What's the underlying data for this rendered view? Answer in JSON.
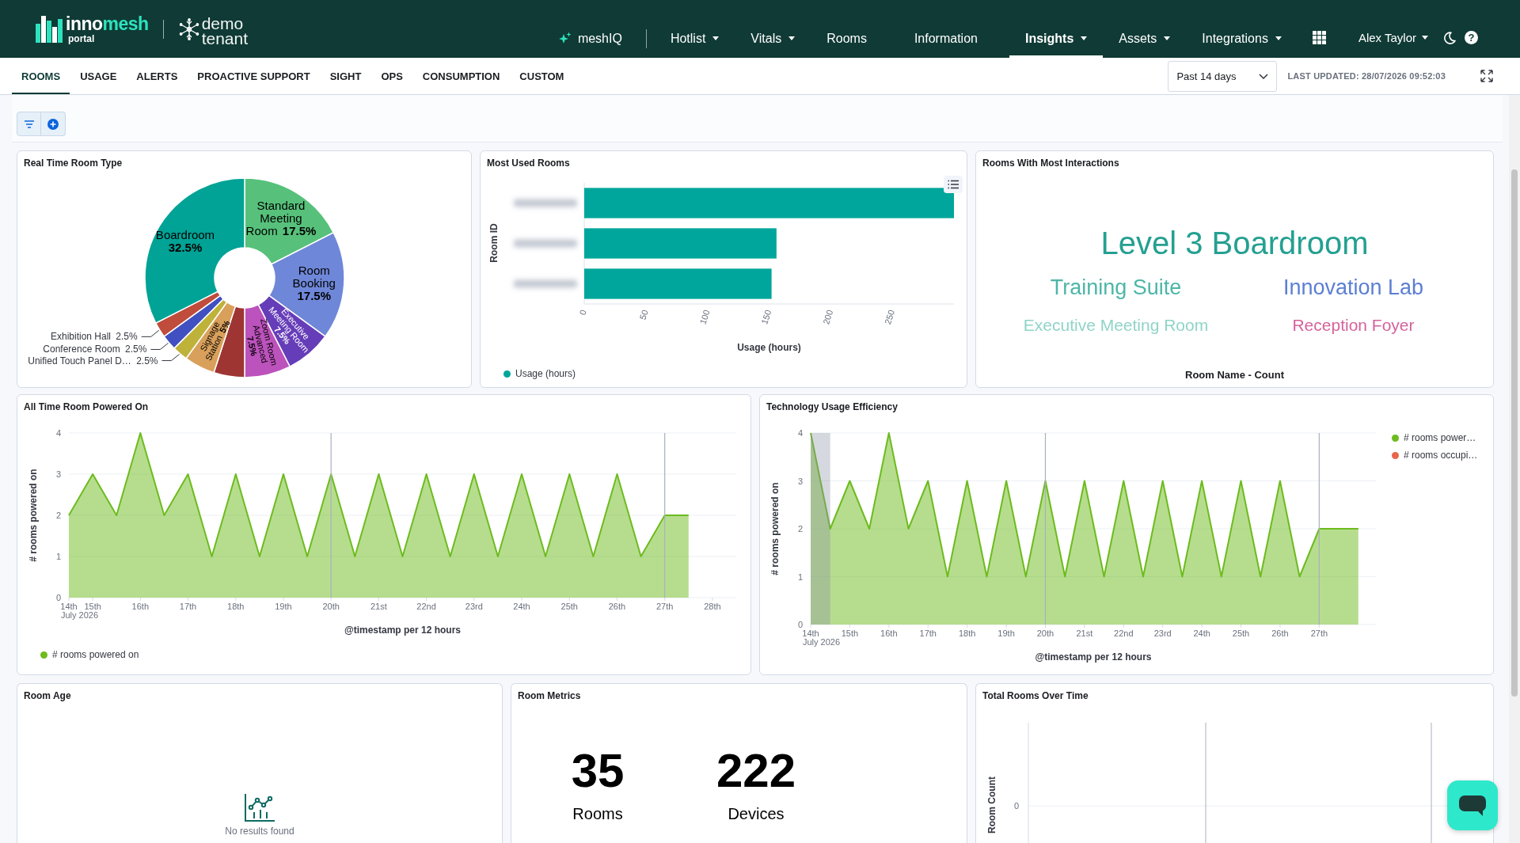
{
  "header": {
    "logo": {
      "text_start": "inno",
      "text_end": "mesh",
      "subtitle": "portal"
    },
    "tenant": "demo tenant",
    "nav": [
      {
        "label": "meshIQ",
        "kind": "assistant",
        "dropdown": false,
        "selected": false
      },
      {
        "label": "Hotlist",
        "kind": "link",
        "dropdown": true,
        "selected": false
      },
      {
        "label": "Vitals",
        "kind": "link",
        "dropdown": true,
        "selected": false
      },
      {
        "label": "Rooms",
        "kind": "link",
        "dropdown": false,
        "selected": false
      },
      {
        "label": "Information",
        "kind": "link",
        "dropdown": false,
        "selected": false
      },
      {
        "label": "Insights",
        "kind": "link",
        "dropdown": true,
        "selected": true
      },
      {
        "label": "Assets",
        "kind": "link",
        "dropdown": true,
        "selected": false
      },
      {
        "label": "Integrations",
        "kind": "link",
        "dropdown": true,
        "selected": false
      }
    ],
    "user": {
      "name": "Alex Taylor"
    },
    "help": "?"
  },
  "tabs": [
    {
      "label": "ROOMS",
      "selected": true
    },
    {
      "label": "USAGE",
      "selected": false
    },
    {
      "label": "ALERTS",
      "selected": false
    },
    {
      "label": "PROACTIVE SUPPORT",
      "selected": false
    },
    {
      "label": "SIGHT",
      "selected": false
    },
    {
      "label": "OPS",
      "selected": false
    },
    {
      "label": "CONSUMPTION",
      "selected": false
    },
    {
      "label": "CUSTOM",
      "selected": false
    }
  ],
  "toolbar": {
    "time_range": "Past 14 days",
    "last_updated": "LAST UPDATED: 28/07/2026 09:52:03"
  },
  "room_type_panel": {
    "title": "Real Time Room Type",
    "chart_data": {
      "type": "donut",
      "categories": [
        "Standard Meeting Room",
        "Room Booking",
        "Executive Meeting Room",
        "Zoom Room Advanced",
        null,
        "Signage Station",
        "Unified Touch Panel D…",
        "Conference Room",
        "Exhibition Hall",
        "Boardroom"
      ],
      "values": [
        17.5,
        17.5,
        7.5,
        7.5,
        5,
        5,
        2.5,
        2.5,
        2.5,
        32.5
      ],
      "value_labels": [
        "17.5%",
        "17.5%",
        "7.5%",
        "7.5%",
        null,
        "5%",
        "2.5%",
        "2.5%",
        "2.5%",
        "32.5%"
      ],
      "colors": [
        "#57c17b",
        "#6f87d8",
        "#663db8",
        "#bc52bc",
        "#9e3533",
        "#d9a05b",
        "#bfb23a",
        "#4050c0",
        "#c04c3c",
        "#00a396"
      ]
    }
  },
  "most_used_rooms_panel": {
    "title": "Most Used Rooms",
    "chart_data": {
      "type": "bar",
      "orientation": "horizontal",
      "xlabel": "Usage (hours)",
      "ylabel": "Room ID",
      "xlim": [
        0,
        300
      ],
      "xticks": [
        0,
        50,
        100,
        150,
        200,
        250
      ],
      "series": [
        {
          "name": "Usage (hours)",
          "color": "#00a69b",
          "values": [
            300,
            156,
            152
          ]
        }
      ]
    }
  },
  "interactions_panel": {
    "title": "Rooms With Most Interactions",
    "words": [
      {
        "text": "Level 3 Boardroom",
        "color": "#24a091"
      },
      {
        "text": "Training Suite",
        "color": "#4db6a8"
      },
      {
        "text": "Innovation Lab",
        "color": "#5c7fd3"
      },
      {
        "text": "Executive Meeting Room",
        "color": "#8fd4c8"
      },
      {
        "text": "Reception Foyer",
        "color": "#d5629c"
      }
    ],
    "caption": "Room Name - Count"
  },
  "powered_on_panel": {
    "title": "All Time Room Powered On",
    "date_caption": "July 2026",
    "chart_data": {
      "type": "area",
      "xlabel": "@timestamp per 12 hours",
      "ylabel": "# rooms powered on",
      "grid": true,
      "x": [
        14.5,
        15,
        15.5,
        16,
        16.5,
        17,
        17.5,
        18,
        18.5,
        19,
        19.5,
        20,
        20.5,
        21,
        21.5,
        22,
        22.5,
        23,
        23.5,
        24,
        24.5,
        25,
        25.5,
        26,
        26.5,
        27,
        27.5
      ],
      "series": [
        {
          "name": "# rooms powered on",
          "color": "#6dbb1e",
          "values": [
            2,
            3,
            2,
            4,
            2,
            3,
            1,
            3,
            1,
            3,
            1,
            3,
            1,
            3,
            1,
            3,
            1,
            3,
            1,
            3,
            1,
            3,
            1,
            3,
            1,
            2,
            2
          ]
        }
      ],
      "xlim": [
        14.5,
        28.5
      ],
      "ylim": [
        0,
        4
      ],
      "yticks": [
        0,
        1,
        2,
        3,
        4
      ],
      "xticks": [
        {
          "value": 14.5,
          "label": "14th"
        },
        {
          "value": 15,
          "label": "15th"
        },
        {
          "value": 16,
          "label": "16th"
        },
        {
          "value": 17,
          "label": "17th"
        },
        {
          "value": 18,
          "label": "18th"
        },
        {
          "value": 19,
          "label": "19th"
        },
        {
          "value": 20,
          "label": "20th"
        },
        {
          "value": 21,
          "label": "21st"
        },
        {
          "value": 22,
          "label": "22nd"
        },
        {
          "value": 23,
          "label": "23rd"
        },
        {
          "value": 24,
          "label": "24th"
        },
        {
          "value": 25,
          "label": "25th"
        },
        {
          "value": 26,
          "label": "26th"
        },
        {
          "value": 27,
          "label": "27th"
        },
        {
          "value": 28,
          "label": "28th"
        }
      ],
      "ref_lines": [
        {
          "axis": "x",
          "value": 20
        },
        {
          "axis": "x",
          "value": 27
        }
      ]
    }
  },
  "efficiency_panel": {
    "title": "Technology Usage Efficiency",
    "date_caption": "July 2026",
    "chart_data": {
      "type": "area",
      "xlabel": "@timestamp per 12 hours",
      "ylabel": "# rooms powered on",
      "grid": true,
      "x": [
        14,
        14.5,
        15,
        15.5,
        16,
        16.5,
        17,
        17.5,
        18,
        18.5,
        19,
        19.5,
        20,
        20.5,
        21,
        21.5,
        22,
        22.5,
        23,
        23.5,
        24,
        24.5,
        25,
        25.5,
        26,
        26.5,
        27,
        27.5,
        28
      ],
      "series": [
        {
          "name": "# rooms power…",
          "color": "#6dbb1e",
          "values": [
            4,
            2,
            3,
            2,
            4,
            2,
            3,
            1,
            3,
            1,
            3,
            1,
            3,
            1,
            3,
            1,
            3,
            1,
            3,
            1,
            3,
            1,
            3,
            1,
            3,
            1,
            2,
            2,
            2
          ]
        },
        {
          "name": "# rooms occupi…",
          "color": "#e7664c",
          "values": [
            null,
            null,
            null,
            null,
            null,
            null,
            null,
            null,
            null,
            null,
            null,
            null,
            null,
            null,
            null,
            null,
            null,
            null,
            null,
            null,
            null,
            null,
            null,
            null,
            null,
            null,
            null,
            null,
            null
          ]
        }
      ],
      "xlim": [
        14,
        28.45
      ],
      "ylim": [
        0,
        4
      ],
      "yticks": [
        0,
        1,
        2,
        3,
        4
      ],
      "xticks": [
        {
          "value": 14,
          "label": "14th"
        },
        {
          "value": 15,
          "label": "15th"
        },
        {
          "value": 16,
          "label": "16th"
        },
        {
          "value": 17,
          "label": "17th"
        },
        {
          "value": 18,
          "label": "18th"
        },
        {
          "value": 19,
          "label": "19th"
        },
        {
          "value": 20,
          "label": "20th"
        },
        {
          "value": 21,
          "label": "21st"
        },
        {
          "value": 22,
          "label": "22nd"
        },
        {
          "value": 23,
          "label": "23rd"
        },
        {
          "value": 24,
          "label": "24th"
        },
        {
          "value": 25,
          "label": "25th"
        },
        {
          "value": 26,
          "label": "26th"
        },
        {
          "value": 27,
          "label": "27th"
        }
      ],
      "bands": [
        {
          "axis": "x",
          "from": 14,
          "to": 14.5
        }
      ],
      "ref_lines": [
        {
          "axis": "x",
          "value": 20
        },
        {
          "axis": "x",
          "value": 27
        }
      ]
    }
  },
  "room_age_panel": {
    "title": "Room Age",
    "empty_message": "No results found"
  },
  "room_metrics_panel": {
    "title": "Room Metrics",
    "metrics": [
      {
        "value": "35",
        "label": "Rooms"
      },
      {
        "value": "222",
        "label": "Devices"
      }
    ]
  },
  "total_rooms_panel": {
    "title": "Total Rooms Over Time",
    "ylabel": "Room Count",
    "ytick": "0"
  }
}
